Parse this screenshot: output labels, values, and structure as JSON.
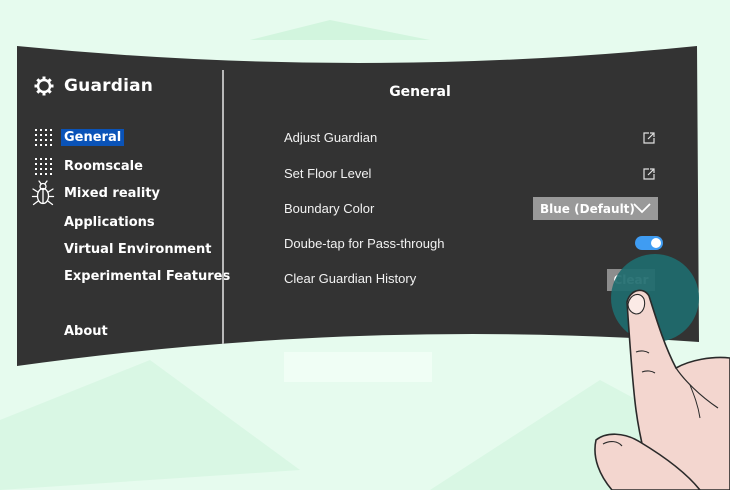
{
  "sidebar": {
    "title": "Guardian",
    "items": [
      {
        "label": "General",
        "icon": "grid-icon",
        "active": true
      },
      {
        "label": "Roomscale",
        "icon": "grid-icon",
        "active": false
      },
      {
        "label": "Mixed reality",
        "icon": "bug-icon",
        "active": false
      },
      {
        "label": "Applications",
        "icon": "",
        "active": false
      },
      {
        "label": "Virtual Environment",
        "icon": "",
        "active": false
      },
      {
        "label": "Experimental Features",
        "icon": "",
        "active": false
      },
      {
        "label": "About",
        "icon": "",
        "active": false
      }
    ]
  },
  "main": {
    "title": "General",
    "rows": [
      {
        "label": "Adjust Guardian",
        "control": "external-link-icon"
      },
      {
        "label": "Set Floor Level",
        "control": "external-link-icon"
      },
      {
        "label": "Boundary Color",
        "control": "dropdown"
      },
      {
        "label": "Doube-tap for Pass-through",
        "control": "toggle"
      },
      {
        "label": "Clear Guardian History",
        "control": "button"
      }
    ],
    "boundary_color_value": "Blue (Default)",
    "pass_through_enabled": true,
    "clear_button_label": "Clear"
  },
  "colors": {
    "panel": "#333333",
    "background": "#e6fbee",
    "active_nav": "#0a53b8",
    "toggle_on": "#3f9cf2",
    "touch_highlight": "#1e6b6e"
  }
}
